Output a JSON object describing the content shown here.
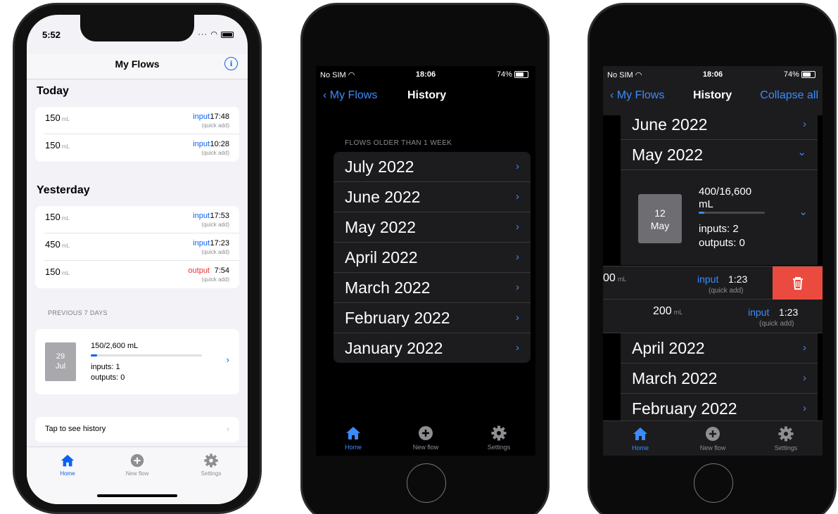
{
  "phone1": {
    "status": {
      "time": "5:52"
    },
    "nav": {
      "title": "My Flows",
      "info_symbol": "i"
    },
    "sections": [
      {
        "title": "Today",
        "rows": [
          {
            "amount": "150",
            "unit": "mL",
            "kind": "input",
            "time": "17:48",
            "note": "(quick add)"
          },
          {
            "amount": "150",
            "unit": "mL",
            "kind": "input",
            "time": "10:28",
            "note": "(quick add)"
          }
        ]
      },
      {
        "title": "Yesterday",
        "rows": [
          {
            "amount": "150",
            "unit": "mL",
            "kind": "input",
            "time": "17:53",
            "note": "(quick add)"
          },
          {
            "amount": "450",
            "unit": "mL",
            "kind": "input",
            "time": "17:23",
            "note": "(quick add)"
          },
          {
            "amount": "150",
            "unit": "mL",
            "kind": "output",
            "time": "7:54",
            "note": "(quick add)"
          }
        ]
      }
    ],
    "previous_caption": "PREVIOUS 7 DAYS",
    "day_card": {
      "day": "29",
      "month": "Jul",
      "total": "150/2,600 mL",
      "progress": 0.06,
      "inputs": "inputs:   1",
      "outputs": "outputs:   0",
      "chevron": "›"
    },
    "history_link": {
      "label": "Tap to see history",
      "chevron": "›"
    },
    "tabs": [
      {
        "label": "Home",
        "icon": "house-icon",
        "active": true
      },
      {
        "label": "New flow",
        "icon": "plus-circle-icon",
        "active": false
      },
      {
        "label": "Settings",
        "icon": "gear-icon",
        "active": false
      }
    ]
  },
  "phone2": {
    "status": {
      "carrier": "No SIM",
      "time": "18:06",
      "battery": "74%"
    },
    "nav": {
      "back": "My Flows",
      "title": "History"
    },
    "caption": "FLOWS OLDER THAN 1 WEEK",
    "months": [
      "July 2022",
      "June 2022",
      "May 2022",
      "April 2022",
      "March 2022",
      "February 2022",
      "January 2022"
    ],
    "chevron": "›",
    "tabs": [
      {
        "label": "Home",
        "icon": "house-icon",
        "active": true
      },
      {
        "label": "New flow",
        "icon": "plus-circle-icon",
        "active": false
      },
      {
        "label": "Settings",
        "icon": "gear-icon",
        "active": false
      }
    ]
  },
  "phone3": {
    "status": {
      "carrier": "No SIM",
      "time": "18:06",
      "battery": "74%"
    },
    "nav": {
      "back": "My Flows",
      "title": "History",
      "action": "Collapse all"
    },
    "months_top": [
      "June 2022",
      "May 2022"
    ],
    "expanded_day": {
      "day": "12",
      "month": "May",
      "total_line1": "400/16,600",
      "total_line2": "mL",
      "progress": 0.024,
      "inputs": "inputs:   2",
      "outputs": "outputs:   0"
    },
    "swiped_row": {
      "amount": "00",
      "unit": "mL",
      "kind": "input",
      "time": "1:23",
      "note": "(quick add)"
    },
    "row": {
      "amount": "200",
      "unit": "mL",
      "kind": "input",
      "time": "1:23",
      "note": "(quick add)"
    },
    "months_bottom": [
      "April 2022",
      "March 2022",
      "February 2022"
    ],
    "chevron": "›",
    "chevron_down": "⌄",
    "tabs": [
      {
        "label": "Home",
        "icon": "house-icon",
        "active": true
      },
      {
        "label": "New flow",
        "icon": "plus-circle-icon",
        "active": false
      },
      {
        "label": "Settings",
        "icon": "gear-icon",
        "active": false
      }
    ]
  }
}
